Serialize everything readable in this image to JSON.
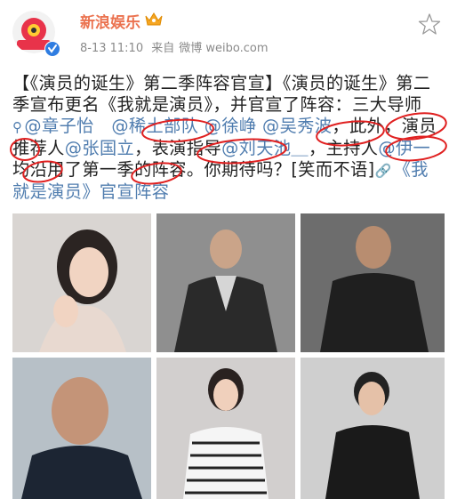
{
  "account": {
    "name": "新浪娱乐",
    "avatar_label": "新浪娱乐",
    "vip_badge": "vip-crown-icon",
    "verified_icon": "verified-v-icon"
  },
  "meta": {
    "date": "8-13 11:10",
    "source_prefix": "来自",
    "source": "微博 weibo.com"
  },
  "post": {
    "t1": "【《演员的诞生》第二季阵容官宣】《演员的诞生》第二季宣布更名《我就是演员》，并官宣了阵容：三大导师",
    "m1": "@章子怡",
    "m2": "@稀土部队",
    "m3": "@徐峥",
    "m4": "@吴秀波",
    "t2": "，此外，演员推荐人",
    "m5": "@张国立",
    "t3": "，表演指导",
    "m6": "@刘天池＿",
    "t4": "，主持人",
    "m7": "@伊一",
    "t5": "均沿用了第一季的阵容。你期待吗？[笑而不语]",
    "link": "《我就是演员》官宣阵容"
  },
  "colors": {
    "brand": "#eb7350",
    "mention": "#507daf",
    "annotation": "#e02020"
  }
}
